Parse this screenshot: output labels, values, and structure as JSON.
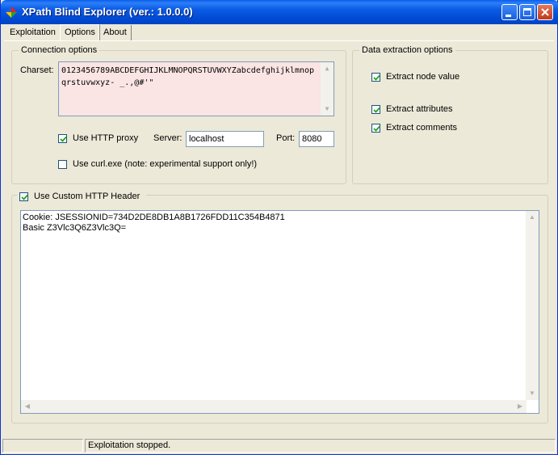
{
  "window": {
    "title": "XPath Blind Explorer (ver.: 1.0.0.0)"
  },
  "tabs": [
    {
      "label": "Exploitation"
    },
    {
      "label": "Options"
    },
    {
      "label": "About"
    }
  ],
  "connection": {
    "group_label": "Connection options",
    "charset_label": "Charset:",
    "charset_value": "0123456789ABCDEFGHIJKLMNOPQRSTUVWXYZabcdefghijklmnopqrstuvwxyz- _.,@#'\"",
    "use_http_proxy": {
      "label": "Use HTTP proxy",
      "checked": true
    },
    "server_label": "Server:",
    "server_value": "localhost",
    "port_label": "Port:",
    "port_value": "8080",
    "use_curl": {
      "label": "Use curl.exe (note: experimental support only!)",
      "checked": false
    }
  },
  "data_extraction": {
    "group_label": "Data extraction options",
    "node_value": {
      "label": "Extract node value",
      "checked": true
    },
    "attributes": {
      "label": "Extract attributes",
      "checked": true
    },
    "comments": {
      "label": "Extract comments",
      "checked": true
    }
  },
  "custom_header": {
    "label": "Use Custom HTTP Header",
    "checked": true,
    "content": "Cookie: JSESSIONID=734D2DE8DB1A8B1726FDD11C354B4871\nBasic Z3Vlc3Q6Z3Vlc3Q="
  },
  "status": {
    "panel1": "",
    "panel2": "Exploitation stopped."
  },
  "colors": {
    "title_bar": "#0054e3",
    "window_bg": "#ece9d8",
    "charset_bg": "#fbe4e4"
  }
}
